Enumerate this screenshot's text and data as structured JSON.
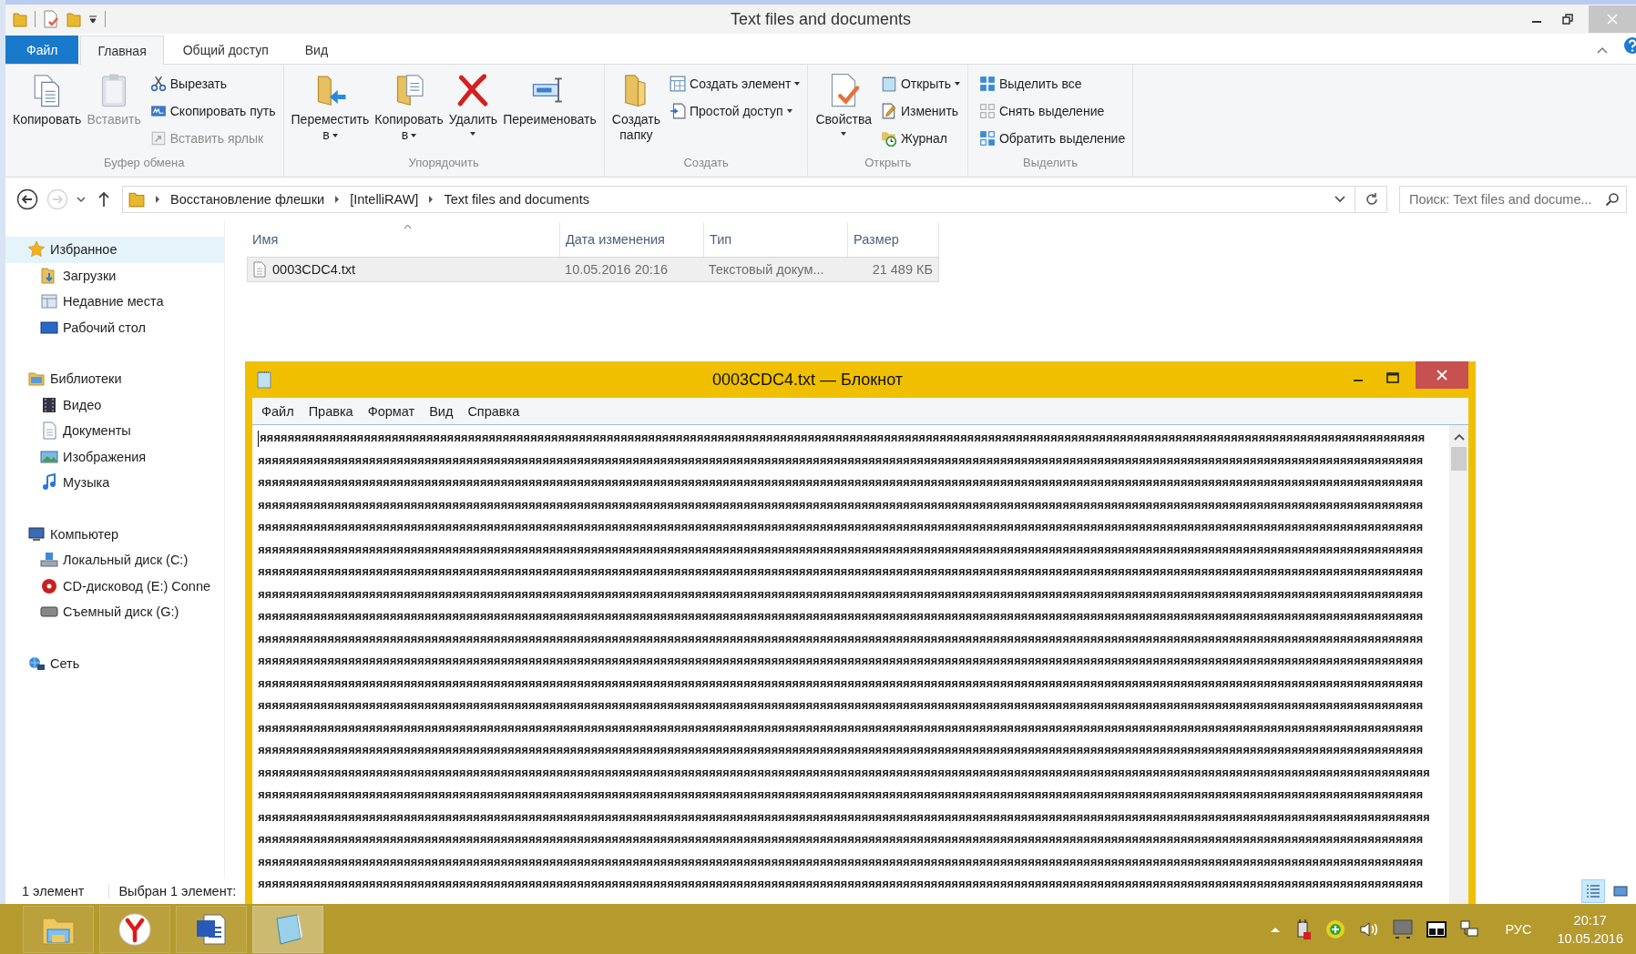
{
  "explorer": {
    "title": "Text files and documents",
    "ribbon_tabs": [
      {
        "label": "Файл",
        "kind": "menu",
        "selected": false
      },
      {
        "label": "Главная",
        "kind": "tab",
        "selected": true
      },
      {
        "label": "Общий доступ",
        "kind": "tab",
        "selected": false
      },
      {
        "label": "Вид",
        "kind": "tab",
        "selected": false
      }
    ],
    "ribbon_groups": [
      {
        "title": "Буфер обмена",
        "large": [
          {
            "lines": [
              "Копировать"
            ],
            "dropdown": false,
            "disabled": false
          },
          {
            "lines": [
              "Вставить"
            ],
            "dropdown": false,
            "disabled": true
          }
        ],
        "small": [
          {
            "label": "Вырезать",
            "dropdown": false,
            "disabled": false
          },
          {
            "label": "Скопировать путь",
            "dropdown": false,
            "disabled": false
          },
          {
            "label": "Вставить ярлык",
            "dropdown": false,
            "disabled": true
          }
        ]
      },
      {
        "title": "Упорядочить",
        "large": [
          {
            "lines": [
              "Переместить",
              "в"
            ],
            "dropdown": true,
            "disabled": false
          },
          {
            "lines": [
              "Копировать",
              "в"
            ],
            "dropdown": true,
            "disabled": false
          },
          {
            "lines": [
              "Удалить"
            ],
            "dropdown": true,
            "disabled": false
          },
          {
            "lines": [
              "Переименовать"
            ],
            "dropdown": false,
            "disabled": false
          }
        ]
      },
      {
        "title": "Создать",
        "large": [
          {
            "lines": [
              "Создать",
              "папку"
            ],
            "dropdown": false,
            "disabled": false
          }
        ],
        "small": [
          {
            "label": "Создать элемент",
            "dropdown": true,
            "disabled": false
          },
          {
            "label": "Простой доступ",
            "dropdown": true,
            "disabled": false
          }
        ]
      },
      {
        "title": "Открыть",
        "large": [
          {
            "lines": [
              "Свойства"
            ],
            "dropdown": true,
            "disabled": false
          }
        ],
        "small": [
          {
            "label": "Открыть",
            "dropdown": true,
            "disabled": false
          },
          {
            "label": "Изменить",
            "dropdown": false,
            "disabled": false
          },
          {
            "label": "Журнал",
            "dropdown": false,
            "disabled": false
          }
        ]
      },
      {
        "title": "Выделить",
        "small": [
          {
            "label": "Выделить все",
            "dropdown": false,
            "disabled": false
          },
          {
            "label": "Снять выделение",
            "dropdown": false,
            "disabled": false
          },
          {
            "label": "Обратить выделение",
            "dropdown": false,
            "disabled": false
          }
        ]
      }
    ],
    "navigation": {
      "back": {
        "disabled": false
      },
      "forward": {
        "disabled": true
      }
    },
    "breadcrumb": [
      "Восстановление флешки",
      "[IntelliRAW]",
      "Text files and documents"
    ],
    "search": {
      "placeholder": "Поиск: Text files and docume..."
    },
    "nav_tree": [
      {
        "label": "Избранное",
        "selected": true,
        "children": [
          {
            "label": "Загрузки",
            "selected": false
          },
          {
            "label": "Недавние места",
            "selected": false
          },
          {
            "label": "Рабочий стол",
            "selected": false
          }
        ]
      },
      {
        "label": "Библиотеки",
        "selected": false,
        "children": [
          {
            "label": "Видео",
            "selected": false
          },
          {
            "label": "Документы",
            "selected": false
          },
          {
            "label": "Изображения",
            "selected": false
          },
          {
            "label": "Музыка",
            "selected": false
          }
        ]
      },
      {
        "label": "Компьютер",
        "selected": false,
        "children": [
          {
            "label": "Локальный диск (C:)",
            "selected": false
          },
          {
            "label": "CD-дисковод (E:) Conne",
            "selected": false
          },
          {
            "label": "Съемный диск (G:)",
            "selected": false
          }
        ]
      },
      {
        "label": "Сеть",
        "selected": false
      }
    ],
    "file_columns": [
      {
        "label": "Имя",
        "sorted": true
      },
      {
        "label": "Дата изменения",
        "sorted": false
      },
      {
        "label": "Тип",
        "sorted": false
      },
      {
        "label": "Размер",
        "sorted": false
      }
    ],
    "file_rows": [
      {
        "cells": [
          "0003CDC4.txt",
          "10.05.2016 20:16",
          "Текстовый докум...",
          "21 489 КБ"
        ],
        "selected": true
      }
    ],
    "status_bar": {
      "count": "1 элемент",
      "selection": "Выбран 1 элемент:"
    },
    "view_buttons": [
      {
        "kind": "details",
        "selected": true
      },
      {
        "kind": "large_icons",
        "selected": false
      }
    ]
  },
  "notepad": {
    "title": "0003CDC4.txt — Блокнот",
    "menu": [
      "Файл",
      "Правка",
      "Формат",
      "Вид",
      "Справка"
    ],
    "lines": [
      "яяяяяяяяяяяяяяяяяяяяяяяяяяяяяяяяяяяяяяяяяяяяяяяяяяяяяяяяяяяяяяяяяяяяяяяяяяяяяяяяяяяяяяяяяяяяяяяяяяяяяяяяяяяяяяяяяяяяяяяяяяяяяяяяяяяяяяяяяяяяяяяяяяяяяяяяяяяяяяяяяяяяяяяя",
      "яяяяяяяяяяяяяяяяяяяяяяяяяяяяяяяяяяяяяяяяяяяяяяяяяяяяяяяяяяяяяяяяяяяяяяяяяяяяяяяяяяяяяяяяяяяяяяяяяяяяяяяяяяяяяяяяяяяяяяяяяяяяяяяяяяяяяяяяяяяяяяяяяяяяяяяяяяяяяяяяяяяяяяяя",
      "яяяяяяяяяяяяяяяяяяяяяяяяяяяяяяяяяяяяяяяяяяяяяяяяяяяяяяяяяяяяяяяяяяяяяяяяяяяяяяяяяяяяяяяяяяяяяяяяяяяяяяяяяяяяяяяяяяяяяяяяяяяяяяяяяяяяяяяяяяяяяяяяяяяяяяяяяяяяяяяяяяяяяяяя",
      "яяяяяяяяяяяяяяяяяяяяяяяяяяяяяяяяяяяяяяяяяяяяяяяяяяяяяяяяяяяяяяяяяяяяяяяяяяяяяяяяяяяяяяяяяяяяяяяяяяяяяяяяяяяяяяяяяяяяяяяяяяяяяяяяяяяяяяяяяяяяяяяяяяяяяяяяяяяяяяяяяяяяяяяя",
      "яяяяяяяяяяяяяяяяяяяяяяяяяяяяяяяяяяяяяяяяяяяяяяяяяяяяяяяяяяяяяяяяяяяяяяяяяяяяяяяяяяяяяяяяяяяяяяяяяяяяяяяяяяяяяяяяяяяяяяяяяяяяяяяяяяяяяяяяяяяяяяяяяяяяяяяяяяяяяяяяяяяяяяяя",
      "яяяяяяяяяяяяяяяяяяяяяяяяяяяяяяяяяяяяяяяяяяяяяяяяяяяяяяяяяяяяяяяяяяяяяяяяяяяяяяяяяяяяяяяяяяяяяяяяяяяяяяяяяяяяяяяяяяяяяяяяяяяяяяяяяяяяяяяяяяяяяяяяяяяяяяяяяяяяяяяяяяяяяяяя",
      "яяяяяяяяяяяяяяяяяяяяяяяяяяяяяяяяяяяяяяяяяяяяяяяяяяяяяяяяяяяяяяяяяяяяяяяяяяяяяяяяяяяяяяяяяяяяяяяяяяяяяяяяяяяяяяяяяяяяяяяяяяяяяяяяяяяяяяяяяяяяяяяяяяяяяяяяяяяяяяяяяяяяяяяя",
      "яяяяяяяяяяяяяяяяяяяяяяяяяяяяяяяяяяяяяяяяяяяяяяяяяяяяяяяяяяяяяяяяяяяяяяяяяяяяяяяяяяяяяяяяяяяяяяяяяяяяяяяяяяяяяяяяяяяяяяяяяяяяяяяяяяяяяяяяяяяяяяяяяяяяяяяяяяяяяяяяяяяяяяяя",
      "яяяяяяяяяяяяяяяяяяяяяяяяяяяяяяяяяяяяяяяяяяяяяяяяяяяяяяяяяяяяяяяяяяяяяяяяяяяяяяяяяяяяяяяяяяяяяяяяяяяяяяяяяяяяяяяяяяяяяяяяяяяяяяяяяяяяяяяяяяяяяяяяяяяяяяяяяяяяяяяяяяяяяяяя",
      "яяяяяяяяяяяяяяяяяяяяяяяяяяяяяяяяяяяяяяяяяяяяяяяяяяяяяяяяяяяяяяяяяяяяяяяяяяяяяяяяяяяяяяяяяяяяяяяяяяяяяяяяяяяяяяяяяяяяяяяяяяяяяяяяяяяяяяяяяяяяяяяяяяяяяяяяяяяяяяяяяяяяяяяя",
      "яяяяяяяяяяяяяяяяяяяяяяяяяяяяяяяяяяяяяяяяяяяяяяяяяяяяяяяяяяяяяяяяяяяяяяяяяяяяяяяяяяяяяяяяяяяяяяяяяяяяяяяяяяяяяяяяяяяяяяяяяяяяяяяяяяяяяяяяяяяяяяяяяяяяяяяяяяяяяяяяяяяяяяяя",
      "яяяяяяяяяяяяяяяяяяяяяяяяяяяяяяяяяяяяяяяяяяяяяяяяяяяяяяяяяяяяяяяяяяяяяяяяяяяяяяяяяяяяяяяяяяяяяяяяяяяяяяяяяяяяяяяяяяяяяяяяяяяяяяяяяяяяяяяяяяяяяяяяяяяяяяяяяяяяяяяяяяяяяяяя",
      "яяяяяяяяяяяяяяяяяяяяяяяяяяяяяяяяяяяяяяяяяяяяяяяяяяяяяяяяяяяяяяяяяяяяяяяяяяяяяяяяяяяяяяяяяяяяяяяяяяяяяяяяяяяяяяяяяяяяяяяяяяяяяяяяяяяяяяяяяяяяяяяяяяяяяяяяяяяяяяяяяяяяяяяя",
      "яяяяяяяяяяяяяяяяяяяяяяяяяяяяяяяяяяяяяяяяяяяяяяяяяяяяяяяяяяяяяяяяяяяяяяяяяяяяяяяяяяяяяяяяяяяяяяяяяяяяяяяяяяяяяяяяяяяяяяяяяяяяяяяяяяяяяяяяяяяяяяяяяяяяяяяяяяяяяяяяяяяяяяяя",
      "яяяяяяяяяяяяяяяяяяяяяяяяяяяяяяяяяяяяяяяяяяяяяяяяяяяяяяяяяяяяяяяяяяяяяяяяяяяяяяяяяяяяяяяяяяяяяяяяяяяяяяяяяяяяяяяяяяяяяяяяяяяяяяяяяяяяяяяяяяяяяяяяяяяяяяяяяяяяяяяяяяяяяяяя",
      "яяяяяяяяяяяяяяяяяяяяяяяяяяяяяяяяяяяяяяяяяяяяяяяяяяяяяяяяяяяяяяяяяяяяяяяяяяяяяяяяяяяяяяяяяяяяяяяяяяяяяяяяяяяяяяяяяяяяяяяяяяяяяяяяяяяяяяяяяяяяяяяяяяяяяяяяяяяяяяяяяяяяяяяяя",
      "яяяяяяяяяяяяяяяяяяяяяяяяяяяяяяяяяяяяяяяяяяяяяяяяяяяяяяяяяяяяяяяяяяяяяяяяяяяяяяяяяяяяяяяяяяяяяяяяяяяяяяяяяяяяяяяяяяяяяяяяяяяяяяяяяяяяяяяяяяяяяяяяяяяяяяяяяяяяяяяяяяяяяяяя",
      "яяяяяяяяяяяяяяяяяяяяяяяяяяяяяяяяяяяяяяяяяяяяяяяяяяяяяяяяяяяяяяяяяяяяяяяяяяяяяяяяяяяяяяяяяяяяяяяяяяяяяяяяяяяяяяяяяяяяяяяяяяяяяяяяяяяяяяяяяяяяяяяяяяяяяяяяяяяяяяяяяяяяяяяяя",
      "яяяяяяяяяяяяяяяяяяяяяяяяяяяяяяяяяяяяяяяяяяяяяяяяяяяяяяяяяяяяяяяяяяяяяяяяяяяяяяяяяяяяяяяяяяяяяяяяяяяяяяяяяяяяяяяяяяяяяяяяяяяяяяяяяяяяяяяяяяяяяяяяяяяяяяяяяяяяяяяяяяяяяяяя",
      "яяяяяяяяяяяяяяяяяяяяяяяяяяяяяяяяяяяяяяяяяяяяяяяяяяяяяяяяяяяяяяяяяяяяяяяяяяяяяяяяяяяяяяяяяяяяяяяяяяяяяяяяяяяяяяяяяяяяяяяяяяяяяяяяяяяяяяяяяяяяяяяяяяяяяяяяяяяяяяяяяяяяяяяя",
      "яяяяяяяяяяяяяяяяяяяяяяяяяяяяяяяяяяяяяяяяяяяяяяяяяяяяяяяяяяяяяяяяяяяяяяяяяяяяяяяяяяяяяяяяяяяяяяяяяяяяяяяяяяяяяяяяяяяяяяяяяяяяяяяяяяяяяяяяяяяяяяяяяяяяяяяяяяяяяяяяяяяяяяяя"
    ]
  },
  "taskbar": {
    "apps": [
      {
        "kind": "explorer",
        "selected": false
      },
      {
        "kind": "browser",
        "selected": false
      },
      {
        "kind": "word",
        "selected": false
      },
      {
        "kind": "notepad",
        "selected": true
      }
    ],
    "language": "РУС",
    "time": "20:17",
    "date": "10.05.2016"
  }
}
